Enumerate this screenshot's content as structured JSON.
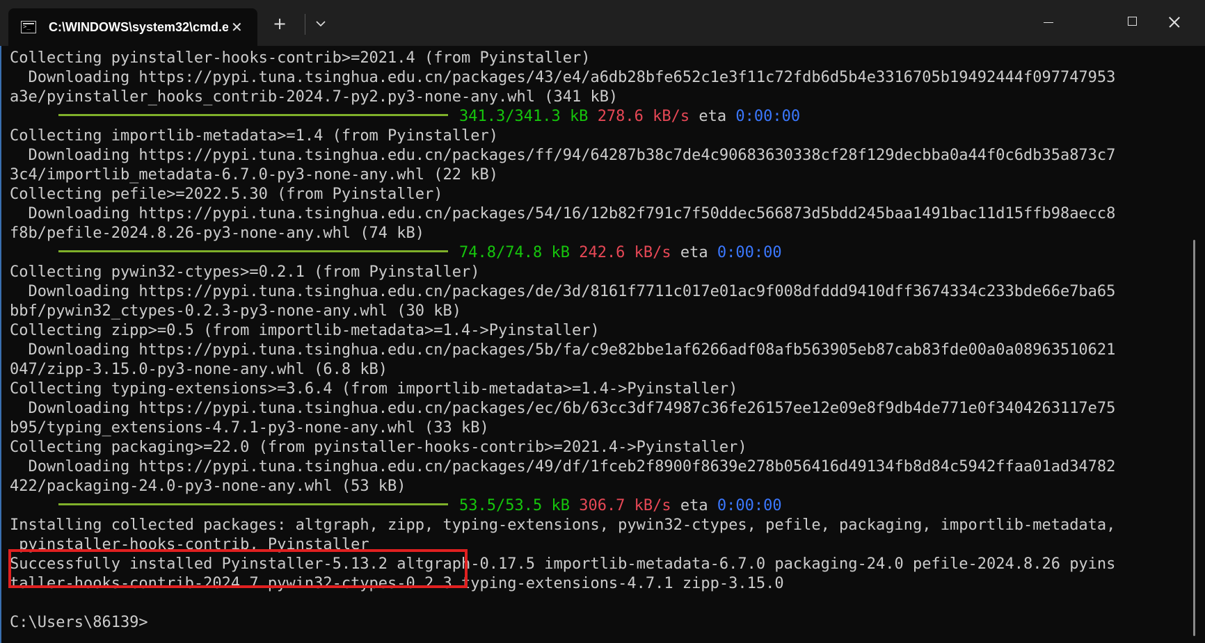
{
  "window": {
    "tab_title": "C:\\WINDOWS\\system32\\cmd.e",
    "new_tab_symbol": "+",
    "close_tab_symbol": "✕"
  },
  "terminal": {
    "lines": [
      "Collecting pyinstaller-hooks-contrib>=2021.4 (from Pyinstaller)",
      "  Downloading https://pypi.tuna.tsinghua.edu.cn/packages/43/e4/a6db28bfe652c1e3f11c72fdb6d5b4e3316705b19492444f097747953",
      "a3e/pyinstaller_hooks_contrib-2024.7-py2.py3-none-any.whl (341 kB)",
      {
        "progress": true,
        "size": "341.3/341.3 kB",
        "speed": "278.6 kB/s",
        "eta_label": "eta",
        "eta": "0:00:00"
      },
      "Collecting importlib-metadata>=1.4 (from Pyinstaller)",
      "  Downloading https://pypi.tuna.tsinghua.edu.cn/packages/ff/94/64287b38c7de4c90683630338cf28f129decbba0a44f0c6db35a873c7",
      "3c4/importlib_metadata-6.7.0-py3-none-any.whl (22 kB)",
      "Collecting pefile>=2022.5.30 (from Pyinstaller)",
      "  Downloading https://pypi.tuna.tsinghua.edu.cn/packages/54/16/12b82f791c7f50ddec566873d5bdd245baa1491bac11d15ffb98aecc8",
      "f8b/pefile-2024.8.26-py3-none-any.whl (74 kB)",
      {
        "progress": true,
        "size": "74.8/74.8 kB",
        "speed": "242.6 kB/s",
        "eta_label": "eta",
        "eta": "0:00:00"
      },
      "Collecting pywin32-ctypes>=0.2.1 (from Pyinstaller)",
      "  Downloading https://pypi.tuna.tsinghua.edu.cn/packages/de/3d/8161f7711c017e01ac9f008dfddd9410dff3674334c233bde66e7ba65",
      "bbf/pywin32_ctypes-0.2.3-py3-none-any.whl (30 kB)",
      "Collecting zipp>=0.5 (from importlib-metadata>=1.4->Pyinstaller)",
      "  Downloading https://pypi.tuna.tsinghua.edu.cn/packages/5b/fa/c9e82bbe1af6266adf08afb563905eb87cab83fde00a0a08963510621",
      "047/zipp-3.15.0-py3-none-any.whl (6.8 kB)",
      "Collecting typing-extensions>=3.6.4 (from importlib-metadata>=1.4->Pyinstaller)",
      "  Downloading https://pypi.tuna.tsinghua.edu.cn/packages/ec/6b/63cc3df74987c36fe26157ee12e09e8f9db4de771e0f3404263117e75",
      "b95/typing_extensions-4.7.1-py3-none-any.whl (33 kB)",
      "Collecting packaging>=22.0 (from pyinstaller-hooks-contrib>=2021.4->Pyinstaller)",
      "  Downloading https://pypi.tuna.tsinghua.edu.cn/packages/49/df/1fceb2f8900f8639e278b056416d49134fb8d84c5942ffaa01ad34782",
      "422/packaging-24.0-py3-none-any.whl (53 kB)",
      {
        "progress": true,
        "size": "53.5/53.5 kB",
        "speed": "306.7 kB/s",
        "eta_label": "eta",
        "eta": "0:00:00"
      },
      "Installing collected packages: altgraph, zipp, typing-extensions, pywin32-ctypes, pefile, packaging, importlib-metadata,",
      " pyinstaller-hooks-contrib, Pyinstaller",
      "Successfully installed Pyinstaller-5.13.2 altgraph-0.17.5 importlib-metadata-6.7.0 packaging-24.0 pefile-2024.8.26 pyins",
      "taller-hooks-contrib-2024.7 pywin32-ctypes-0.2.3 typing-extensions-4.7.1 zipp-3.15.0",
      "",
      "C:\\Users\\86139>"
    ]
  }
}
